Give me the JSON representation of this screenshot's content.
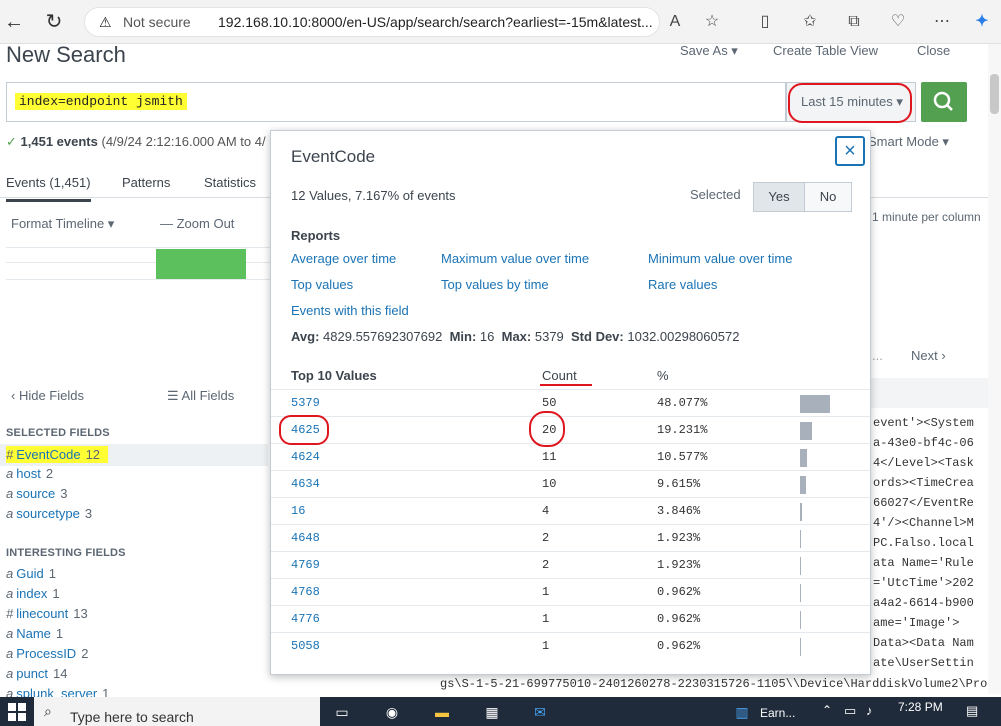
{
  "browser": {
    "back_icon": "back-arrow-icon",
    "refresh_icon": "refresh-icon",
    "security_label": "Not secure",
    "url": "192.168.10.10:8000/en-US/app/search/search?earliest=-15m&latest...",
    "menu_icon": "ellipsis-icon"
  },
  "header": {
    "title": "New Search",
    "save_as": "Save As ▾",
    "create_table_view": "Create Table View",
    "close": "Close"
  },
  "search": {
    "query": "index=endpoint jsmith",
    "time_range": "Last 15 minutes ▾",
    "event_summary_count": "1,451 events",
    "event_summary_range": "(4/9/24 2:12:16.000 AM to 4/",
    "mode": "Smart Mode ▾"
  },
  "tabs": [
    {
      "label": "Events (1,451)"
    },
    {
      "label": "Patterns"
    },
    {
      "label": "Statistics"
    }
  ],
  "timeline": {
    "format": "Format Timeline ▾",
    "zoom_out": "— Zoom Out",
    "per_column": "1 minute per column",
    "next": "Next ›",
    "ellipsis": "..."
  },
  "fields": {
    "hide_fields": "‹ Hide Fields",
    "all_fields": "☰ All Fields",
    "selected_heading": "SELECTED FIELDS",
    "selected": [
      {
        "type": "#",
        "name": "EventCode",
        "count": "12"
      },
      {
        "type": "a",
        "name": "host",
        "count": "2"
      },
      {
        "type": "a",
        "name": "source",
        "count": "3"
      },
      {
        "type": "a",
        "name": "sourcetype",
        "count": "3"
      }
    ],
    "interesting_heading": "INTERESTING FIELDS",
    "interesting": [
      {
        "type": "a",
        "name": "Guid",
        "count": "1"
      },
      {
        "type": "a",
        "name": "index",
        "count": "1"
      },
      {
        "type": "#",
        "name": "linecount",
        "count": "13"
      },
      {
        "type": "a",
        "name": "Name",
        "count": "1"
      },
      {
        "type": "a",
        "name": "ProcessID",
        "count": "2"
      },
      {
        "type": "a",
        "name": "punct",
        "count": "14"
      },
      {
        "type": "a",
        "name": "splunk_server",
        "count": "1"
      }
    ]
  },
  "raw_events": [
    "event'><System",
    "a-43e0-bf4c-06",
    "4</Level><Task",
    "ords><TimeCrea",
    "66027</EventRe",
    "4'/><Channel>M",
    "PC.Falso.local",
    "ata Name='Rule",
    "='UtcTime'>202",
    "a4a2-6614-b900",
    "ame='Image'>",
    "Data><Data Nam",
    "ate\\UserSettin"
  ],
  "bottom_raw": "gs\\S-1-5-21-699775010-2401260278-2230315726-1105\\\\Device\\HarddiskVolume2\\Pro",
  "popup": {
    "title": "EventCode",
    "summary": "12 Values, 7.167% of events",
    "selected_label": "Selected",
    "yes": "Yes",
    "no": "No",
    "reports_heading": "Reports",
    "reports": [
      "Average over time",
      "Maximum value over time",
      "Minimum value over time",
      "Top values",
      "Top values by time",
      "Rare values",
      "Events with this field"
    ],
    "stats": {
      "avg_label": "Avg:",
      "avg": "4829.557692307692",
      "min_label": "Min:",
      "min": "16",
      "max_label": "Max:",
      "max": "5379",
      "std_label": "Std Dev:",
      "std": "1032.00298060572"
    },
    "table_headers": {
      "values": "Top 10 Values",
      "count": "Count",
      "pct": "%"
    },
    "rows": [
      {
        "value": "5379",
        "count": "50",
        "pct": "48.077%",
        "share": 0.48077
      },
      {
        "value": "4625",
        "count": "20",
        "pct": "19.231%",
        "share": 0.19231
      },
      {
        "value": "4624",
        "count": "11",
        "pct": "10.577%",
        "share": 0.10577
      },
      {
        "value": "4634",
        "count": "10",
        "pct": "9.615%",
        "share": 0.09615
      },
      {
        "value": "16",
        "count": "4",
        "pct": "3.846%",
        "share": 0.03846
      },
      {
        "value": "4648",
        "count": "2",
        "pct": "1.923%",
        "share": 0.01923
      },
      {
        "value": "4769",
        "count": "2",
        "pct": "1.923%",
        "share": 0.01923
      },
      {
        "value": "4768",
        "count": "1",
        "pct": "0.962%",
        "share": 0.00962
      },
      {
        "value": "4776",
        "count": "1",
        "pct": "0.962%",
        "share": 0.00962
      },
      {
        "value": "5058",
        "count": "1",
        "pct": "0.962%",
        "share": 0.00962
      }
    ]
  },
  "taskbar": {
    "search_placeholder": "Type here to search",
    "earn_label": "Earn...",
    "time": "7:28 PM"
  },
  "colors": {
    "accent_green": "#53a051",
    "link_blue": "#1a73b5",
    "highlight_yellow": "#ffff33",
    "annotation_red": "#e0161e"
  }
}
